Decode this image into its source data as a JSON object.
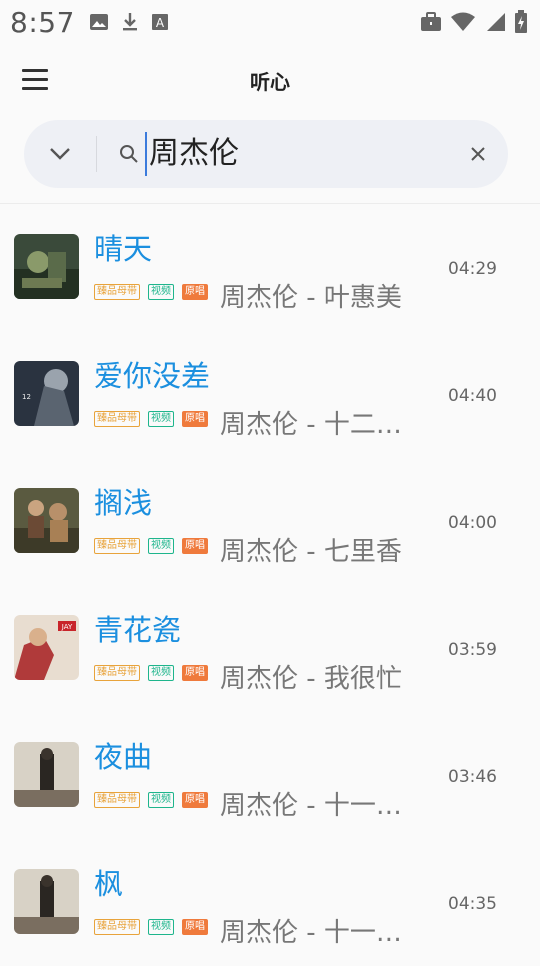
{
  "status": {
    "time": "8:57",
    "left_icons": [
      "image-icon",
      "download-icon",
      "font-icon"
    ],
    "right_icons": [
      "briefcase-icon",
      "wifi-icon",
      "signal-icon",
      "battery-icon"
    ]
  },
  "header": {
    "title": "听心",
    "menu_icon": "menu-icon"
  },
  "search": {
    "query": "周杰伦",
    "dropdown_icon": "chevron-down-icon",
    "search_icon": "search-icon",
    "clear_icon": "close-icon"
  },
  "tags": {
    "master": "臻品母带",
    "video": "视频",
    "original": "原唱"
  },
  "songs": [
    {
      "title": "晴天",
      "artist": "周杰伦 - 叶惠美",
      "duration": "04:29"
    },
    {
      "title": "爱你没差",
      "artist": "周杰伦 - 十二新作",
      "duration": "04:40"
    },
    {
      "title": "搁浅",
      "artist": "周杰伦 - 七里香",
      "duration": "04:00"
    },
    {
      "title": "青花瓷",
      "artist": "周杰伦 - 我很忙",
      "duration": "03:59"
    },
    {
      "title": "夜曲",
      "artist": "周杰伦 - 十一月的萧邦",
      "duration": "03:46"
    },
    {
      "title": "枫",
      "artist": "周杰伦 - 十一月的萧邦",
      "duration": "04:35"
    }
  ],
  "colors": {
    "title_blue": "#1b8fdf",
    "tag_master": "#e8a33b",
    "tag_video": "#1eb58c",
    "tag_original": "#ef7a3c"
  }
}
